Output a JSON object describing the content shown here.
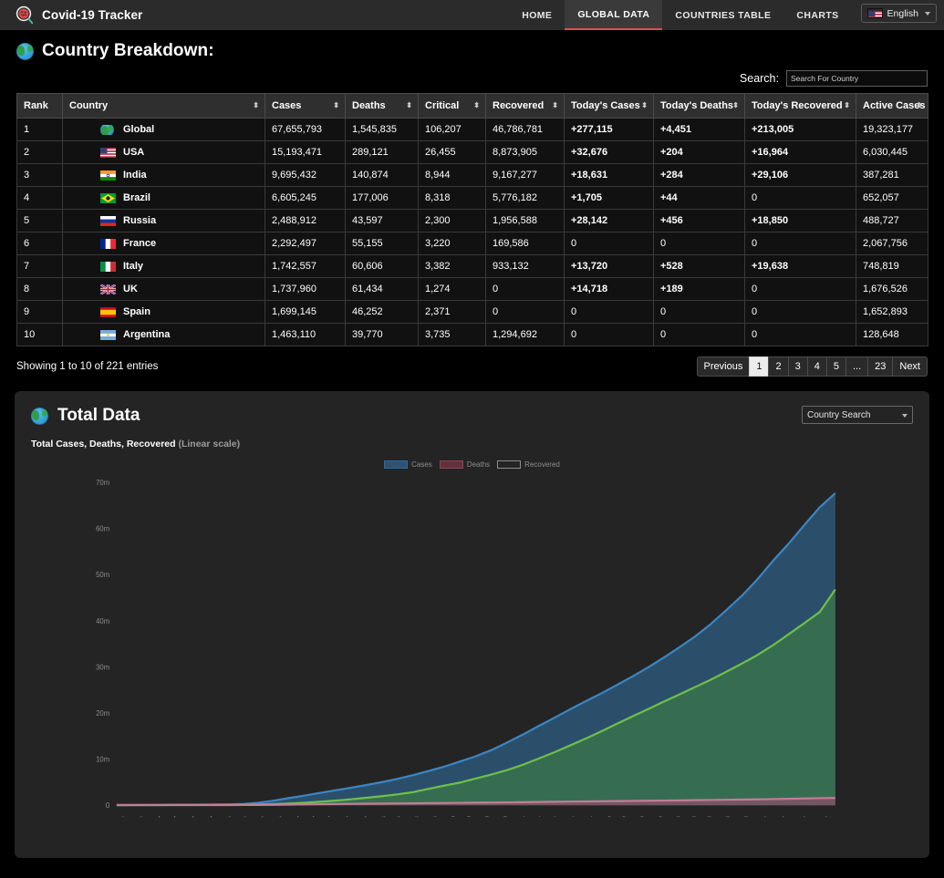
{
  "navbar": {
    "logo_icon": "virus-magnifier-icon",
    "brand": "Covid-19 Tracker",
    "links": [
      {
        "label": "HOME",
        "active": false
      },
      {
        "label": "GLOBAL DATA",
        "active": true
      },
      {
        "label": "COUNTRIES TABLE",
        "active": false
      },
      {
        "label": "CHARTS",
        "active": false
      }
    ],
    "language": {
      "label": "English",
      "flag": "us-flag-icon",
      "caret": "chevron-down-icon"
    },
    "accent_color": "#d9534f",
    "bg_color": "#2b2b2b"
  },
  "page": {
    "title": "Country Breakdown:",
    "title_icon": "globe-icon"
  },
  "search": {
    "label": "Search:",
    "placeholder": "Search For Country",
    "value": ""
  },
  "table": {
    "columns": [
      {
        "label": "Rank",
        "sortable": false
      },
      {
        "label": "Country",
        "sortable": true
      },
      {
        "label": "Cases",
        "sortable": true
      },
      {
        "label": "Deaths",
        "sortable": true
      },
      {
        "label": "Critical",
        "sortable": true
      },
      {
        "label": "Recovered",
        "sortable": true
      },
      {
        "label": "Today's Cases",
        "sortable": true
      },
      {
        "label": "Today's Deaths",
        "sortable": true
      },
      {
        "label": "Today's Recovered",
        "sortable": true
      },
      {
        "label": "Active Cases",
        "sortable": true
      }
    ],
    "rows": [
      {
        "rank": "1",
        "country": "Global",
        "flag": "globe-icon",
        "cases": "67,655,793",
        "deaths": "1,545,835",
        "critical": "106,207",
        "recovered": "46,786,781",
        "today_cases": "+277,115",
        "today_deaths": "+4,451",
        "today_recovered": "+213,005",
        "active": "19,323,177"
      },
      {
        "rank": "2",
        "country": "USA",
        "flag": "us-flag-icon",
        "cases": "15,193,471",
        "deaths": "289,121",
        "critical": "26,455",
        "recovered": "8,873,905",
        "today_cases": "+32,676",
        "today_deaths": "+204",
        "today_recovered": "+16,964",
        "active": "6,030,445"
      },
      {
        "rank": "3",
        "country": "India",
        "flag": "india-flag-icon",
        "cases": "9,695,432",
        "deaths": "140,874",
        "critical": "8,944",
        "recovered": "9,167,277",
        "today_cases": "+18,631",
        "today_deaths": "+284",
        "today_recovered": "+29,106",
        "active": "387,281"
      },
      {
        "rank": "4",
        "country": "Brazil",
        "flag": "brazil-flag-icon",
        "cases": "6,605,245",
        "deaths": "177,006",
        "critical": "8,318",
        "recovered": "5,776,182",
        "today_cases": "+1,705",
        "today_deaths": "+44",
        "today_recovered": "0",
        "active": "652,057"
      },
      {
        "rank": "5",
        "country": "Russia",
        "flag": "russia-flag-icon",
        "cases": "2,488,912",
        "deaths": "43,597",
        "critical": "2,300",
        "recovered": "1,956,588",
        "today_cases": "+28,142",
        "today_deaths": "+456",
        "today_recovered": "+18,850",
        "active": "488,727"
      },
      {
        "rank": "6",
        "country": "France",
        "flag": "france-flag-icon",
        "cases": "2,292,497",
        "deaths": "55,155",
        "critical": "3,220",
        "recovered": "169,586",
        "today_cases": "0",
        "today_deaths": "0",
        "today_recovered": "0",
        "active": "2,067,756"
      },
      {
        "rank": "7",
        "country": "Italy",
        "flag": "italy-flag-icon",
        "cases": "1,742,557",
        "deaths": "60,606",
        "critical": "3,382",
        "recovered": "933,132",
        "today_cases": "+13,720",
        "today_deaths": "+528",
        "today_recovered": "+19,638",
        "active": "748,819"
      },
      {
        "rank": "8",
        "country": "UK",
        "flag": "uk-flag-icon",
        "cases": "1,737,960",
        "deaths": "61,434",
        "critical": "1,274",
        "recovered": "0",
        "today_cases": "+14,718",
        "today_deaths": "+189",
        "today_recovered": "0",
        "active": "1,676,526"
      },
      {
        "rank": "9",
        "country": "Spain",
        "flag": "spain-flag-icon",
        "cases": "1,699,145",
        "deaths": "46,252",
        "critical": "2,371",
        "recovered": "0",
        "today_cases": "0",
        "today_deaths": "0",
        "today_recovered": "0",
        "active": "1,652,893"
      },
      {
        "rank": "10",
        "country": "Argentina",
        "flag": "argentina-flag-icon",
        "cases": "1,463,110",
        "deaths": "39,770",
        "critical": "3,735",
        "recovered": "1,294,692",
        "today_cases": "0",
        "today_deaths": "0",
        "today_recovered": "0",
        "active": "128,648"
      }
    ],
    "showing": "Showing 1 to 10 of 221 entries",
    "pagination": {
      "previous": "Previous",
      "pages": [
        "1",
        "2",
        "3",
        "4",
        "5",
        "...",
        "23"
      ],
      "next": "Next",
      "active_page": "1"
    },
    "highlight_colors": {
      "today_cases": "#ffeeba",
      "today_deaths": "#e2696b",
      "today_recovered": "#74dd92"
    }
  },
  "total_data": {
    "title": "Total Data",
    "title_icon": "globe-icon",
    "country_search": {
      "value": "Country Search",
      "caret": "chevron-down-icon"
    },
    "subtitle_main": "Total Cases, Deaths, Recovered",
    "subtitle_muted": "(Linear scale)"
  },
  "chart_data": {
    "type": "area",
    "title": "Total Cases, Deaths, Recovered (Linear scale)",
    "xlabel": "",
    "ylabel": "",
    "ylim": [
      0,
      72000000
    ],
    "yticks": [
      0,
      10000000,
      20000000,
      30000000,
      40000000,
      50000000,
      60000000,
      70000000
    ],
    "ytick_labels": [
      "0",
      "10m",
      "20m",
      "30m",
      "40m",
      "50m",
      "60m",
      "70m"
    ],
    "grid": false,
    "legend": [
      "Cases",
      "Deaths",
      "Recovered"
    ],
    "legend_position": "top-center",
    "colors": {
      "Cases": "#3a7fb5",
      "Deaths": "#c47c96",
      "Recovered": "#6fc04a"
    },
    "x": [
      "1/22/20",
      "1/29/20",
      "2/5/20",
      "2/12/20",
      "2/19/20",
      "2/26/20",
      "3/4/20",
      "3/11/20",
      "3/18/20",
      "3/25/20",
      "4/1/20",
      "4/8/20",
      "4/15/20",
      "4/22/20",
      "4/29/20",
      "5/6/20",
      "5/13/20",
      "5/20/20",
      "5/27/20",
      "6/3/20",
      "6/10/20",
      "6/17/20",
      "6/24/20",
      "7/1/20",
      "7/8/20",
      "7/15/20",
      "7/22/20",
      "7/29/20",
      "8/5/20",
      "8/12/20",
      "8/19/20",
      "8/26/20",
      "9/2/20",
      "9/9/20",
      "9/16/20",
      "9/23/20",
      "9/30/20",
      "10/7/20",
      "10/14/20",
      "10/21/20",
      "10/28/20",
      "11/4/20",
      "11/11/20",
      "11/18/20",
      "11/25/20",
      "12/2/20",
      "12/7/20"
    ],
    "series": [
      {
        "name": "Cases",
        "values": [
          555,
          6166,
          28276,
          45221,
          75725,
          81397,
          95124,
          126378,
          214910,
          471035,
          932605,
          1511104,
          2034802,
          2629064,
          3193886,
          3755341,
          4347018,
          4995172,
          5694172,
          6515344,
          7428730,
          8380549,
          9473214,
          10604468,
          11952694,
          13586080,
          15296674,
          17128906,
          18902735,
          20730456,
          22492312,
          24189417,
          26020736,
          27875126,
          29836896,
          31947845,
          34183221,
          36518980,
          39194912,
          42226661,
          45352504,
          48919061,
          52950371,
          56659046,
          60690506,
          64602436,
          67655793
        ]
      },
      {
        "name": "Deaths",
        "values": [
          17,
          133,
          565,
          1118,
          2126,
          2770,
          3254,
          4643,
          8774,
          21284,
          47043,
          88338,
          132758,
          184249,
          227647,
          263888,
          296984,
          328166,
          355803,
          384669,
          418444,
          450069,
          484274,
          514730,
          546447,
          583767,
          624598,
          668911,
          709280,
          751704,
          789334,
          825984,
          863987,
          903094,
          940851,
          978188,
          1016790,
          1058152,
          1102518,
          1147301,
          1188683,
          1234060,
          1297060,
          1356088,
          1428185,
          1495918,
          1545835
        ]
      },
      {
        "name": "Recovered",
        "values": [
          28,
          126,
          1291,
          5014,
          17906,
          30128,
          51170,
          68224,
          83313,
          114749,
          193181,
          325441,
          496199,
          709900,
          958465,
          1244841,
          1579371,
          1927776,
          2331244,
          2823131,
          3543465,
          4229232,
          4894244,
          5766119,
          6636414,
          7594533,
          8748184,
          10063770,
          11425431,
          12897073,
          14397310,
          15942795,
          17596155,
          19216424,
          20791562,
          22391121,
          23966858,
          25554192,
          27153427,
          28881060,
          30654302,
          32513741,
          34643295,
          37026519,
          39425618,
          41868230,
          46786781
        ]
      }
    ]
  }
}
